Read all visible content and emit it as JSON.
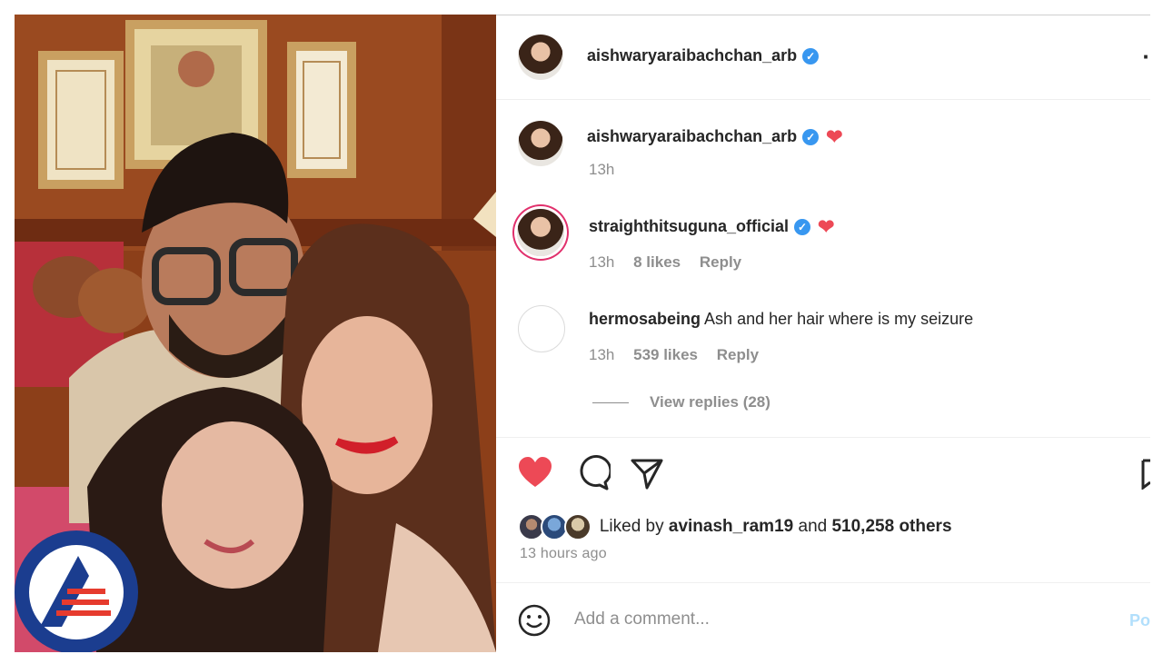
{
  "post": {
    "header": {
      "username": "aishwaryaraibachchan_arb",
      "more_icon": "more-options-icon"
    },
    "caption": {
      "username": "aishwaryaraibachchan_arb",
      "emoji": "❤️",
      "time": "13h"
    },
    "comments": [
      {
        "username": "straighthitsuguna_official",
        "emoji": "❤️",
        "time": "13h",
        "likes": "8 likes",
        "reply": "Reply"
      },
      {
        "username": "hermosabeing",
        "text": "Ash and her hair where is my seizure",
        "time": "13h",
        "likes": "539 likes",
        "reply": "Reply",
        "view_replies": "View replies (28)"
      }
    ],
    "actions": {
      "liked": true,
      "like_icon": "heart-icon",
      "comment_icon": "comment-icon",
      "share_icon": "send-icon",
      "save_icon": "bookmark-icon"
    },
    "likes": {
      "prefix": "Liked by ",
      "user": "avinash_ram19",
      "and": " and ",
      "others": "510,258 others"
    },
    "posted_ago": "13 hours ago",
    "comment_box": {
      "placeholder": "Add a comment...",
      "emoji_icon": "smiley-icon",
      "post_label": "Po"
    }
  },
  "colors": {
    "like_red": "#ed4956",
    "verified_blue": "#3897f0",
    "muted": "#8e8e8e",
    "watermark_blue": "#1b3d8f"
  }
}
